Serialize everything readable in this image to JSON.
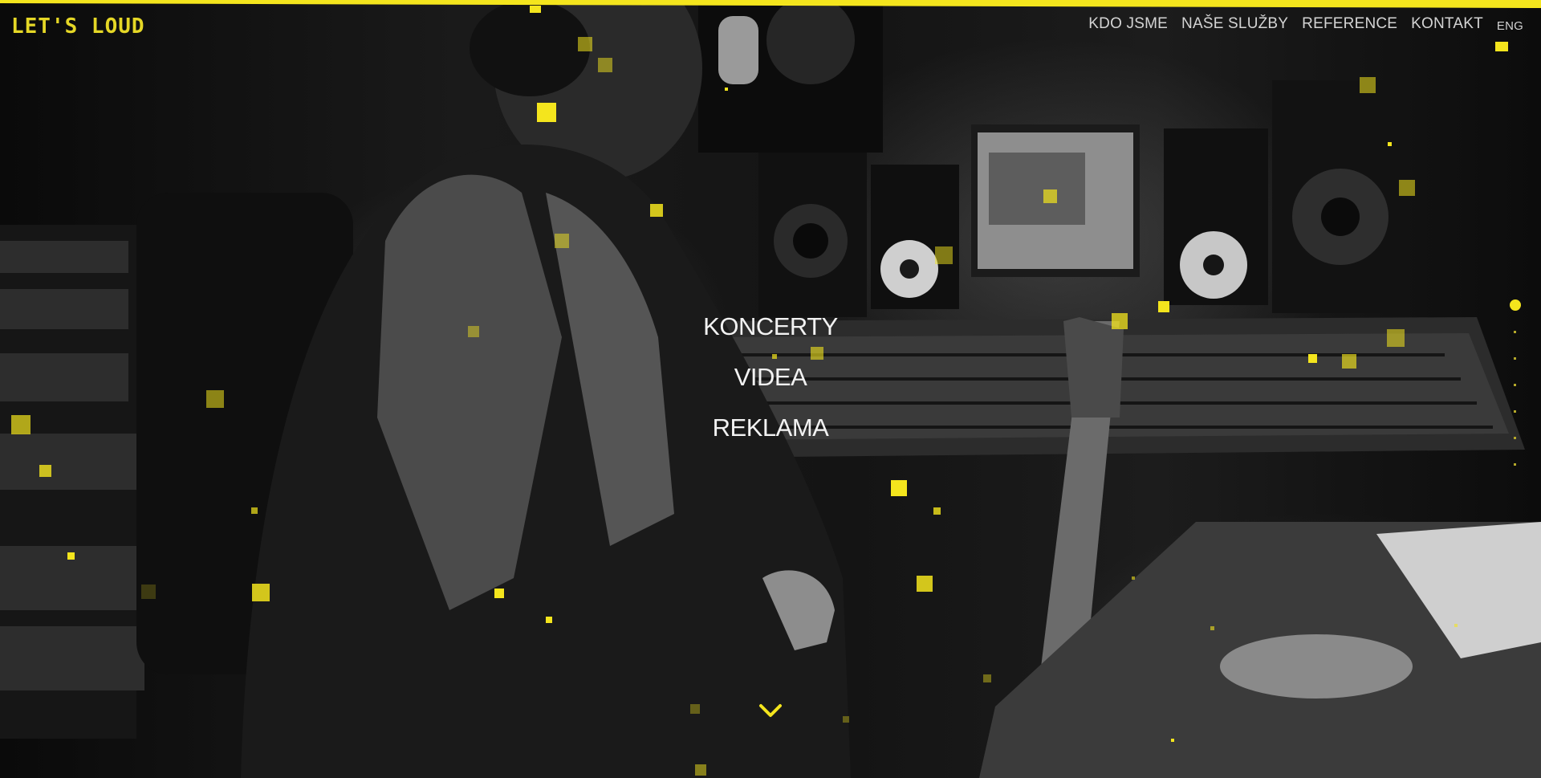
{
  "brand": {
    "logo_text": "LET'S LOUD",
    "accent_color": "#f4e51d"
  },
  "nav": {
    "items": [
      {
        "label": "KDO JSME"
      },
      {
        "label": "NAŠE SLUŽBY"
      },
      {
        "label": "REFERENCE"
      },
      {
        "label": "KONTAKT"
      }
    ],
    "language": "ENG"
  },
  "hero": {
    "categories": [
      {
        "label": "KONCERTY"
      },
      {
        "label": "VIDEA"
      },
      {
        "label": "REKLAMA"
      }
    ],
    "scroll_icon": "chevron-down-icon",
    "background": "black-and-white photo of a musician in a recording studio"
  }
}
